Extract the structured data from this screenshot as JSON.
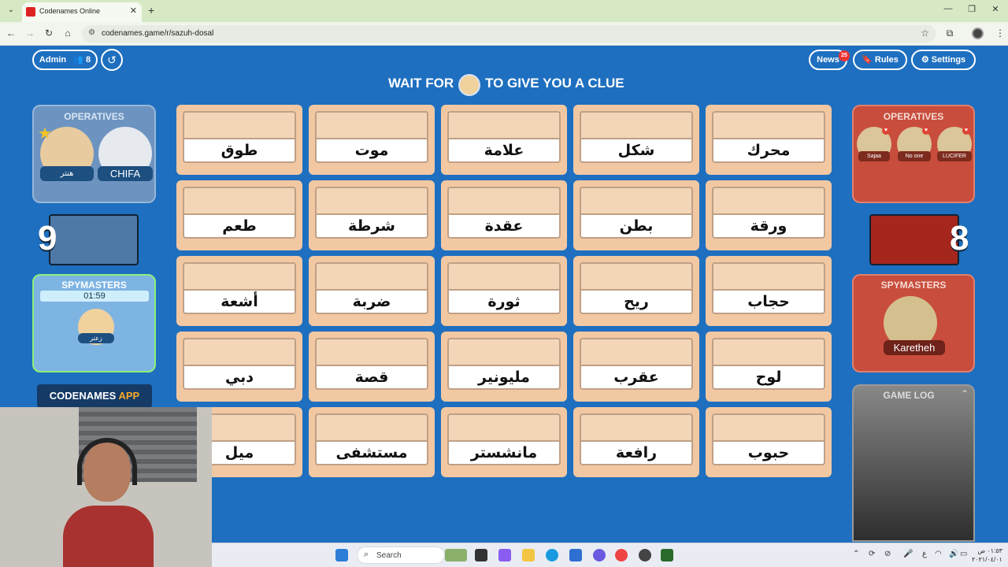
{
  "browser": {
    "tab_title": "Codenames Online",
    "url": "codenames.game/r/sazuh-dosal"
  },
  "topbar": {
    "admin_label": "Admin",
    "player_count": "8",
    "news_label": "News",
    "news_badge": "25",
    "rules_label": "Rules",
    "settings_label": "Settings"
  },
  "clue_message": {
    "prefix": "WAIT FOR",
    "suffix": "TO GIVE YOU A CLUE"
  },
  "blue_team": {
    "operatives_title": "OPERATIVES",
    "operatives": [
      "هنتر",
      "CHIFA"
    ],
    "remaining": "9",
    "spymasters_title": "SPYMASTERS",
    "timer": "01:59",
    "spymaster": "زعتر"
  },
  "red_team": {
    "operatives_title": "OPERATIVES",
    "operatives": [
      "Sajaa",
      "No one",
      "LUCIFER"
    ],
    "remaining": "8",
    "spymasters_title": "SPYMASTERS",
    "spymaster": "Karetheh"
  },
  "app_banner": {
    "main": "CODENAMES",
    "accent": "APP"
  },
  "game_log": {
    "title": "GAME LOG"
  },
  "board": {
    "rows": [
      [
        "طوق",
        "موت",
        "علامة",
        "شكل",
        "محرك"
      ],
      [
        "طعم",
        "شرطة",
        "عقدة",
        "بطن",
        "ورقة"
      ],
      [
        "أشعة",
        "ضربة",
        "ثورة",
        "ريح",
        "حجاب"
      ],
      [
        "دبي",
        "قصة",
        "مليونير",
        "عقرب",
        "لوح"
      ],
      [
        "ميل",
        "مستشفى",
        "مانشستر",
        "رافعة",
        "حبوب"
      ]
    ]
  },
  "taskbar": {
    "search_placeholder": "Search",
    "lang": "ع",
    "time": "٠١:٥٣ ص",
    "date": "٢٠٢١/٠٤/٠١"
  },
  "colors": {
    "background": "#1e6fbf",
    "blue_panel": "#6d94c0",
    "red_panel": "#c84d3c",
    "card": "#f2c8a3"
  }
}
